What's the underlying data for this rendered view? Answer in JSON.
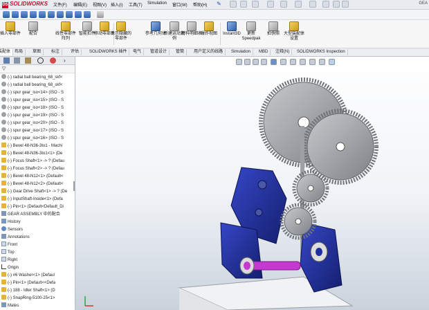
{
  "app": {
    "logo_text": "SOLIDWORKS",
    "window_title_fragment": "GEA"
  },
  "menu": [
    "文件(F)",
    "编辑(E)",
    "视图(V)",
    "插入(I)",
    "工具(T)",
    "Simulation",
    "窗口(W)",
    "帮助(H)"
  ],
  "command_manager": {
    "items": [
      "插入零部件",
      "配合",
      "线性零部件阵列",
      "智能扣件",
      "移动零部件",
      "显示隐藏的零部件",
      "参考几何体",
      "新建运动算例",
      "材料明细表",
      "爆炸视图",
      "Instant3D",
      "更新 Speedpak",
      "拍快照",
      "大型装配体设置"
    ]
  },
  "tabs": [
    "装配体",
    "布局",
    "草图",
    "标注",
    "评估",
    "SOLIDWORKS 插件",
    "电气",
    "管道设计",
    "管筒",
    "用户定义的线路",
    "Simulation",
    "MBD",
    "注释(N)",
    "SOLIDWORKS Inspection"
  ],
  "tree": {
    "items": [
      {
        "icon": "gear-icon",
        "label": "(-) radial ball bearing_68_skf<"
      },
      {
        "icon": "gear-icon",
        "label": "(-) radial ball bearing_68_skf<"
      },
      {
        "icon": "gear-icon",
        "label": "(-) spur gear_iso<14> (ISO - S"
      },
      {
        "icon": "gear-icon",
        "label": "(-) spur gear_iso<15> (ISO - S"
      },
      {
        "icon": "gear-icon",
        "label": "(-) spur gear_iso<18> (ISO - S"
      },
      {
        "icon": "gear-icon",
        "label": "(-) spur gear_iso<19> (ISO - S"
      },
      {
        "icon": "gear-icon",
        "label": "(-) spur gear_iso<20> (ISO - S"
      },
      {
        "icon": "gear-icon",
        "label": "(-) spur gear_iso<17> (ISO - S"
      },
      {
        "icon": "gear-icon",
        "label": "(-) spur gear_iso<16> (ISO - S"
      },
      {
        "icon": "assembly-icon",
        "label": "(-) Bevel 48-N36-3to1 - Machi"
      },
      {
        "icon": "assembly-icon",
        "label": "(-) Bevel 48-N36-3to1<1> (De"
      },
      {
        "icon": "assembly-icon",
        "label": "(-) Focus Shaft<1> -> ? (Defau"
      },
      {
        "icon": "assembly-icon",
        "label": "(-) Focus Shaft<2> -> ? (Defau"
      },
      {
        "icon": "assembly-icon",
        "label": "(-) Bevel 48-N12<1> (Default<"
      },
      {
        "icon": "assembly-icon",
        "label": "(-) Bevel 48-N12<2> (Default<"
      },
      {
        "icon": "assembly-icon",
        "label": "(-) Gear Drive Shaft<1> -> ? (De"
      },
      {
        "icon": "assembly-icon",
        "label": "(-) InputShaft-Inside<1> (Defa"
      },
      {
        "icon": "assembly-icon",
        "label": "(-) Pin<1> (Default<Default_Di"
      },
      {
        "icon": "folder-icon",
        "label": "GEAR ASSEMBLY 中的配合"
      },
      {
        "icon": "folder-icon",
        "label": "History"
      },
      {
        "icon": "sensor-icon",
        "label": "Sensors"
      },
      {
        "icon": "annotation-icon",
        "label": "Annotations"
      },
      {
        "icon": "plane-icon",
        "label": "Front"
      },
      {
        "icon": "plane-icon",
        "label": "Top"
      },
      {
        "icon": "plane-icon",
        "label": "Right"
      },
      {
        "icon": "origin-icon",
        "label": "Origin"
      },
      {
        "icon": "assembly-icon",
        "label": "(-) #6 Washer<1> (Defaul"
      },
      {
        "icon": "assembly-icon",
        "label": "(-) Pin<1> (Default<<Defa"
      },
      {
        "icon": "assembly-icon",
        "label": "(-) 188 - Idler Shaft<1> (D"
      },
      {
        "icon": "assembly-icon",
        "label": "(-) SnapRing-5100-25<1>"
      },
      {
        "icon": "folder-icon",
        "label": "Mates"
      }
    ]
  },
  "colors": {
    "accent": "#c8102e",
    "part_blue": "#1d2f9c",
    "gear_gray": "#8e9297",
    "shaft_magenta": "#c43ad0"
  }
}
